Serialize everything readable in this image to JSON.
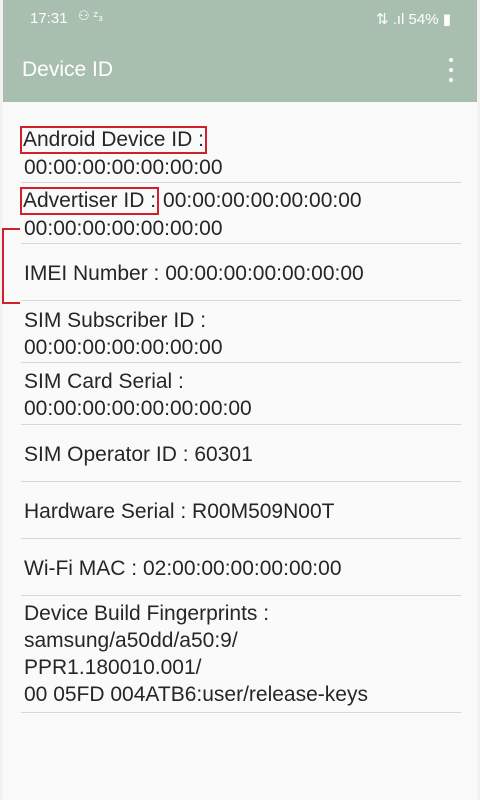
{
  "status_bar": {
    "time": "17:31",
    "left_icons": "⚇ ᶻ₃",
    "battery": "54%"
  },
  "app_bar": {
    "title": "Device ID"
  },
  "rows": {
    "android_id": {
      "label": "Android Device ID :",
      "value": "00:00:00:00:00:00:00"
    },
    "advertiser_id": {
      "label": "Advertiser ID :",
      "value_line1": "00:00:00:00:00:00:00",
      "value_line2": "00:00:00:00:00:00:00"
    },
    "imei": {
      "text": "IMEI Number : 00:00:00:00:00:00:00"
    },
    "sim_subscriber": {
      "label": "SIM Subscriber ID :",
      "value": "00:00:00:00:00:00:00"
    },
    "sim_card": {
      "label": "SIM Card Serial :",
      "value": "00:00:00:00:00:00:00:00"
    },
    "sim_operator": {
      "text": "SIM Operator ID : 60301"
    },
    "hardware_serial": {
      "text": "Hardware Serial : R00M509N00T"
    },
    "wifi_mac": {
      "text": "Wi-Fi MAC : 02:00:00:00:00:00:00"
    },
    "fingerprint": {
      "label": "Device Build Fingerprints :",
      "line1": "samsung/a50dd/a50:9/",
      "line2": "PPR1.180010.001/",
      "line3": "00 05FD 004ATB6:user/release-keys"
    }
  },
  "colors": {
    "app_bar": "#a8bfb0",
    "highlight": "#d0202a"
  }
}
